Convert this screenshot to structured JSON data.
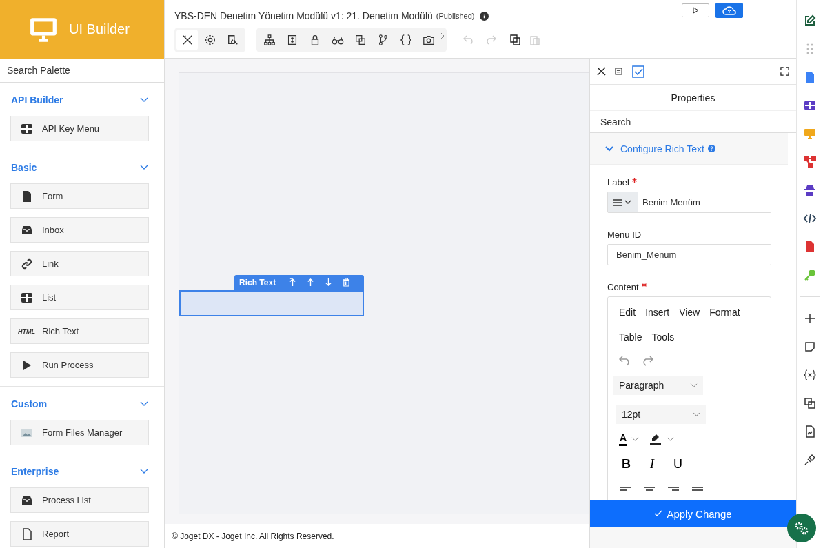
{
  "brand": {
    "title": "UI Builder"
  },
  "header": {
    "title": "YBS-DEN Denetim Yönetim Modülü v1: 21. Denetim Modülü",
    "status": "(Published)"
  },
  "mode_tabs": [
    {
      "selected": true
    },
    {
      "selected": false
    },
    {
      "selected": false
    }
  ],
  "palette": {
    "search_placeholder": "Search Palette",
    "sections": [
      {
        "title": "API Builder",
        "expanded": true,
        "items": [
          {
            "label": "API Key Menu",
            "kind": "grid"
          }
        ]
      },
      {
        "title": "Basic",
        "expanded": true,
        "items": [
          {
            "label": "Form",
            "kind": "form"
          },
          {
            "label": "Inbox",
            "kind": "inbox"
          },
          {
            "label": "Link",
            "kind": "link"
          },
          {
            "label": "List",
            "kind": "grid"
          },
          {
            "label": "Rich Text",
            "kind": "html",
            "icon_text": "HTML"
          },
          {
            "label": "Run Process",
            "kind": "play"
          }
        ]
      },
      {
        "title": "Custom",
        "expanded": true,
        "items": [
          {
            "label": "Form Files Manager",
            "kind": "image"
          }
        ]
      },
      {
        "title": "Enterprise",
        "expanded": true,
        "items": [
          {
            "label": "Process List",
            "kind": "inbox"
          },
          {
            "label": "Report",
            "kind": "report"
          }
        ]
      }
    ]
  },
  "canvas": {
    "element": {
      "label": "Rich Text"
    }
  },
  "footer": "© Joget DX - Joget Inc. All Rights Reserved.",
  "panel": {
    "views": [
      {
        "selected": false
      },
      {
        "selected": true
      }
    ],
    "title": "Properties",
    "search_placeholder": "Search",
    "section": {
      "title": "Configure Rich Text",
      "expanded": true
    },
    "fields": [
      {
        "label": "Label",
        "required": true,
        "kind": "addon",
        "value": "Benim Menüm"
      },
      {
        "label": "Menu ID",
        "required": false,
        "kind": "text",
        "value": "Benim_Menum"
      }
    ],
    "content": {
      "label": "Content",
      "required": true,
      "menus": [
        "Edit",
        "Insert",
        "View",
        "Format",
        "Table",
        "Tools"
      ],
      "block_format": "Paragraph",
      "font_size": "12pt",
      "text_color_glyph": "A",
      "format_buttons": [
        "B",
        "I",
        "U"
      ]
    },
    "apply_button": "Apply Change"
  }
}
